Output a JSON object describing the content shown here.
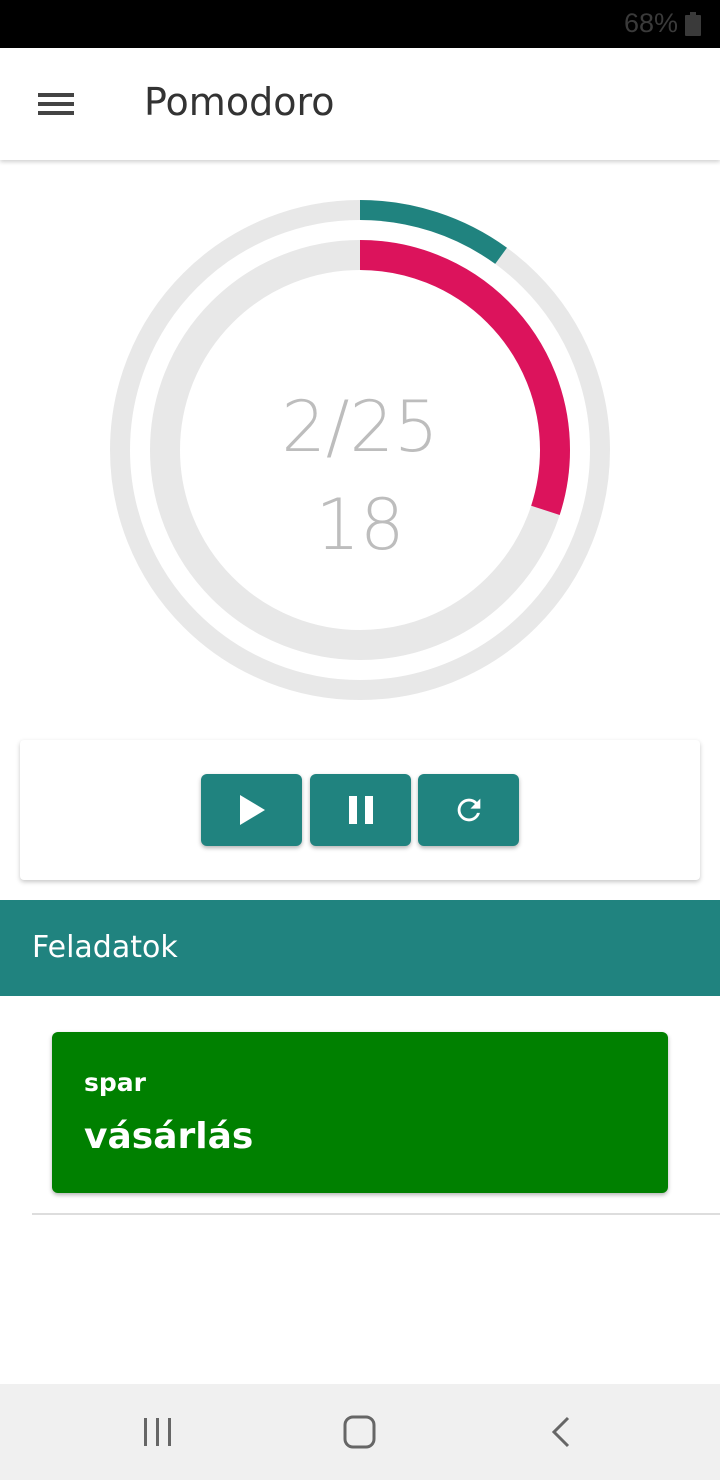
{
  "status_bar": {
    "battery": "68%",
    "icons": [
      "battery-icon"
    ]
  },
  "app_bar": {
    "title": "Pomodoro",
    "icons": [
      "menu-icon"
    ]
  },
  "timer": {
    "label": "2/25",
    "value": "18",
    "outer_progress": 0.1,
    "inner_progress": 0.3,
    "outer_color": "#20837f",
    "inner_color": "#dc135c",
    "track_color": "#e8e8e8"
  },
  "controls": {
    "icons": [
      "play-icon",
      "pause-icon",
      "refresh-icon"
    ],
    "button_color": "#20837f"
  },
  "tasks": {
    "header": "Feladatok",
    "header_color": "#20837f",
    "items": [
      {
        "subtitle": "spar",
        "title": "vásárlás",
        "color": "#008000"
      }
    ]
  },
  "nav_bar": {
    "icons": [
      "recent-apps-icon",
      "home-icon",
      "back-icon"
    ]
  }
}
